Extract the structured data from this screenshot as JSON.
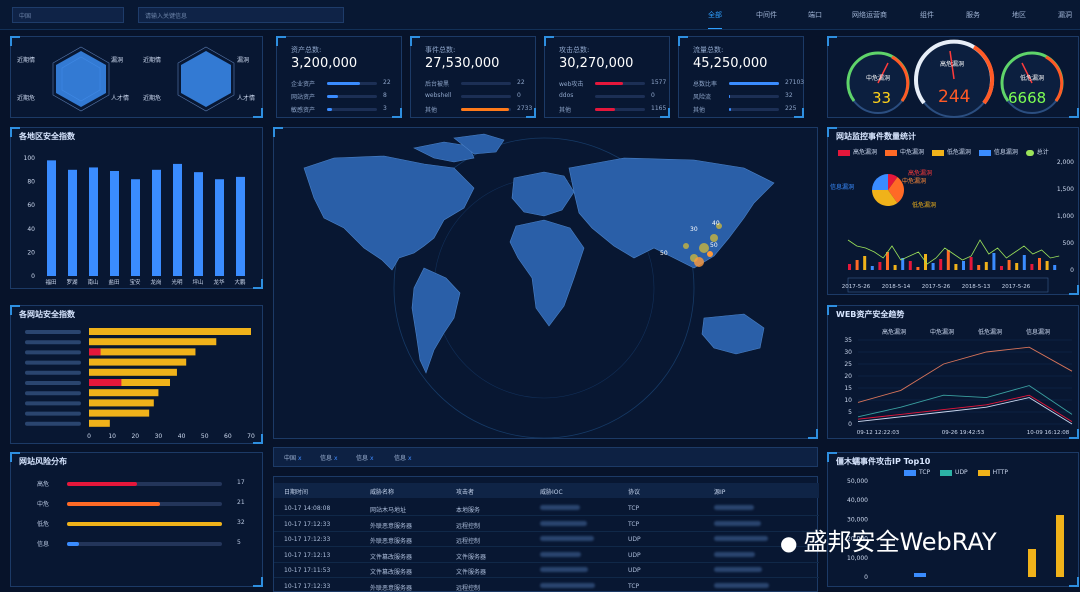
{
  "topbar": {
    "search1": "中国",
    "search2": "请输入关键信息",
    "nav": [
      "全部",
      "中间件",
      "端口",
      "网络运营商",
      "组件",
      "服务",
      "地区",
      "漏洞"
    ]
  },
  "radar": {
    "labels_left": [
      "漏洞",
      "近期情",
      "近期危"
    ],
    "labels_right": [
      "威胁情",
      "漏洞",
      "人才情",
      "近期危"
    ]
  },
  "stats": [
    {
      "label": "资产总数:",
      "value": "3,200,000",
      "rows": [
        {
          "t": "企业资产",
          "v": "22",
          "pct": 0.65,
          "c": "#3a8cff"
        },
        {
          "t": "网站资产",
          "v": "8",
          "pct": 0.22,
          "c": "#3a8cff"
        },
        {
          "t": "敏感资产",
          "v": "3",
          "pct": 0.1,
          "c": "#3a8cff"
        }
      ]
    },
    {
      "label": "事件总数:",
      "value": "27,530,000",
      "rows": [
        {
          "t": "后台被黑",
          "v": "22",
          "pct": 0.0,
          "c": "#3a8cff"
        },
        {
          "t": "webshell",
          "v": "0",
          "pct": 0.0,
          "c": "#3a8cff"
        },
        {
          "t": "其他",
          "v": "2733",
          "pct": 0.95,
          "c": "#ff7a1a"
        }
      ]
    },
    {
      "label": "攻击总数:",
      "value": "30,270,000",
      "rows": [
        {
          "t": "web攻击",
          "v": "1577",
          "pct": 0.55,
          "c": "#e5173b"
        },
        {
          "t": "ddos",
          "v": "0",
          "pct": 0.0,
          "c": "#3a8cff"
        },
        {
          "t": "其他",
          "v": "1165",
          "pct": 0.4,
          "c": "#e5173b"
        }
      ]
    },
    {
      "label": "流量总数:",
      "value": "45,250,000",
      "rows": [
        {
          "t": "总数比率",
          "v": "27103",
          "pct": 1.0,
          "c": "#3a8cff"
        },
        {
          "t": "风险流",
          "v": "32",
          "pct": 0.02,
          "c": "#3a8cff"
        },
        {
          "t": "其他",
          "v": "225",
          "pct": 0.04,
          "c": "#3a8cff"
        }
      ]
    }
  ],
  "gauges": [
    {
      "label": "中危漏洞",
      "value": "33",
      "color": "#ffd21a"
    },
    {
      "label": "高危漏洞",
      "value": "244",
      "color": "#ff5a26"
    },
    {
      "label": "低危漏洞",
      "value": "6668",
      "color": "#7dff54"
    }
  ],
  "regions": {
    "title": "各地区安全指数",
    "yticks": [
      "100",
      "80",
      "60",
      "40",
      "20",
      "0"
    ],
    "chart_data": {
      "type": "bar",
      "categories": [
        "福田",
        "罗湖",
        "南山",
        "盐田",
        "宝安",
        "龙岗",
        "光明",
        "坪山",
        "龙华",
        "大鹏"
      ],
      "values": [
        98,
        90,
        92,
        89,
        82,
        90,
        95,
        88,
        82,
        84
      ],
      "ylim": [
        0,
        100
      ]
    }
  },
  "sites": {
    "title": "各网站安全指数",
    "xticks": [
      "0",
      "10",
      "20",
      "30",
      "40",
      "50",
      "60",
      "70"
    ],
    "chart_data": {
      "type": "bar",
      "orientation": "horizontal",
      "values": [
        70,
        55,
        46,
        42,
        38,
        35,
        30,
        28,
        26,
        9
      ],
      "highlight": [
        0,
        0,
        5,
        0,
        0,
        14,
        0,
        0,
        0,
        0
      ],
      "xlim": [
        0,
        70
      ]
    }
  },
  "risk": {
    "title": "网站风险分布",
    "rows": [
      {
        "t": "高危",
        "v": "17",
        "pct": 0.45,
        "c": "#e5173b"
      },
      {
        "t": "中危",
        "v": "21",
        "pct": 0.6,
        "c": "#ff6a26"
      },
      {
        "t": "低危",
        "v": "32",
        "pct": 1.0,
        "c": "#f0b21a"
      },
      {
        "t": "信息",
        "v": "5",
        "pct": 0.08,
        "c": "#3a8cff"
      }
    ]
  },
  "map": {
    "labels": [
      "30",
      "40",
      "50",
      "50",
      "40",
      "50"
    ]
  },
  "monitor": {
    "title": "网站监控事件数量统计",
    "legend": [
      "高危漏洞",
      "中危漏洞",
      "低危漏洞",
      "信息漏洞",
      "总计"
    ],
    "pie_labels": [
      "高危漏洞",
      "中危漏洞",
      "低危漏洞",
      "信息漏洞"
    ],
    "yticks": [
      "2,000",
      "1,500",
      "1,000",
      "500",
      "0"
    ],
    "dates": [
      "2017-5-26",
      "2018-5-14",
      "2017-5-26",
      "2018-5-13",
      "2017-5-26"
    ],
    "chart_data": {
      "type": "bar",
      "pie": [
        10,
        30,
        35,
        25
      ]
    }
  },
  "trend": {
    "title": "WEB资产安全趋势",
    "legend": [
      "高危漏洞",
      "中危漏洞",
      "低危漏洞",
      "信息漏洞"
    ],
    "yticks": [
      "35",
      "30",
      "25",
      "20",
      "15",
      "10",
      "5",
      "0"
    ],
    "xticks": [
      "09-12 12:22:03",
      "09-26 19:42:53",
      "10-09 16:12:08"
    ],
    "chart_data": {
      "type": "line",
      "x": [
        "09-12 12:22:03",
        "09-26 19:42:53",
        "10-09 16:12:08"
      ],
      "series": [
        {
          "name": "高危漏洞",
          "values": [
            9,
            14,
            25,
            30,
            32,
            22
          ]
        },
        {
          "name": "中危漏洞",
          "values": [
            3,
            7,
            12,
            11,
            16,
            4
          ]
        },
        {
          "name": "低危漏洞",
          "values": [
            2,
            4,
            6,
            8,
            12,
            1
          ]
        },
        {
          "name": "信息漏洞",
          "values": [
            1,
            3,
            5,
            7,
            11,
            0
          ]
        }
      ],
      "ylim": [
        0,
        35
      ]
    }
  },
  "top10": {
    "title": "僵木蠕事件攻击IP Top10",
    "legend": [
      "TCP",
      "UDP",
      "HTTP"
    ],
    "yticks": [
      "50,000",
      "40,000",
      "30,000",
      "20,000",
      "10,000",
      "0"
    ],
    "chart_data": {
      "type": "bar",
      "series": [
        {
          "name": "TCP",
          "values": [
            3000,
            0,
            0
          ]
        },
        {
          "name": "UDP",
          "values": [
            0,
            0,
            0
          ]
        },
        {
          "name": "HTTP",
          "values": [
            0,
            15000,
            33000
          ]
        }
      ]
    }
  },
  "tabs": [
    "中国",
    "信息",
    "信息",
    "信息"
  ],
  "table": {
    "headers": [
      "日期时间",
      "威胁名称",
      "攻击者",
      "威胁IOC",
      "协议",
      "源IP"
    ],
    "rows": [
      [
        "10-17 14:08:08",
        "网站木马地址",
        "本地服务",
        "",
        "TCP",
        ""
      ],
      [
        "10-17 17:12:33",
        "外联恶意服务器",
        "远程控制",
        "",
        "TCP",
        ""
      ],
      [
        "10-17 17:12:33",
        "外联恶意服务器",
        "远程控制",
        "",
        "UDP",
        ""
      ],
      [
        "10-17 17:12:13",
        "文件篡改服务器",
        "文件服务器",
        "",
        "UDP",
        ""
      ],
      [
        "10-17 17:11:53",
        "文件篡改服务器",
        "文件服务器",
        "",
        "UDP",
        ""
      ],
      [
        "10-17 17:12:33",
        "外联恶意服务器",
        "远程控制",
        "",
        "TCP",
        ""
      ]
    ]
  },
  "watermark": "盛邦安全WebRAY"
}
